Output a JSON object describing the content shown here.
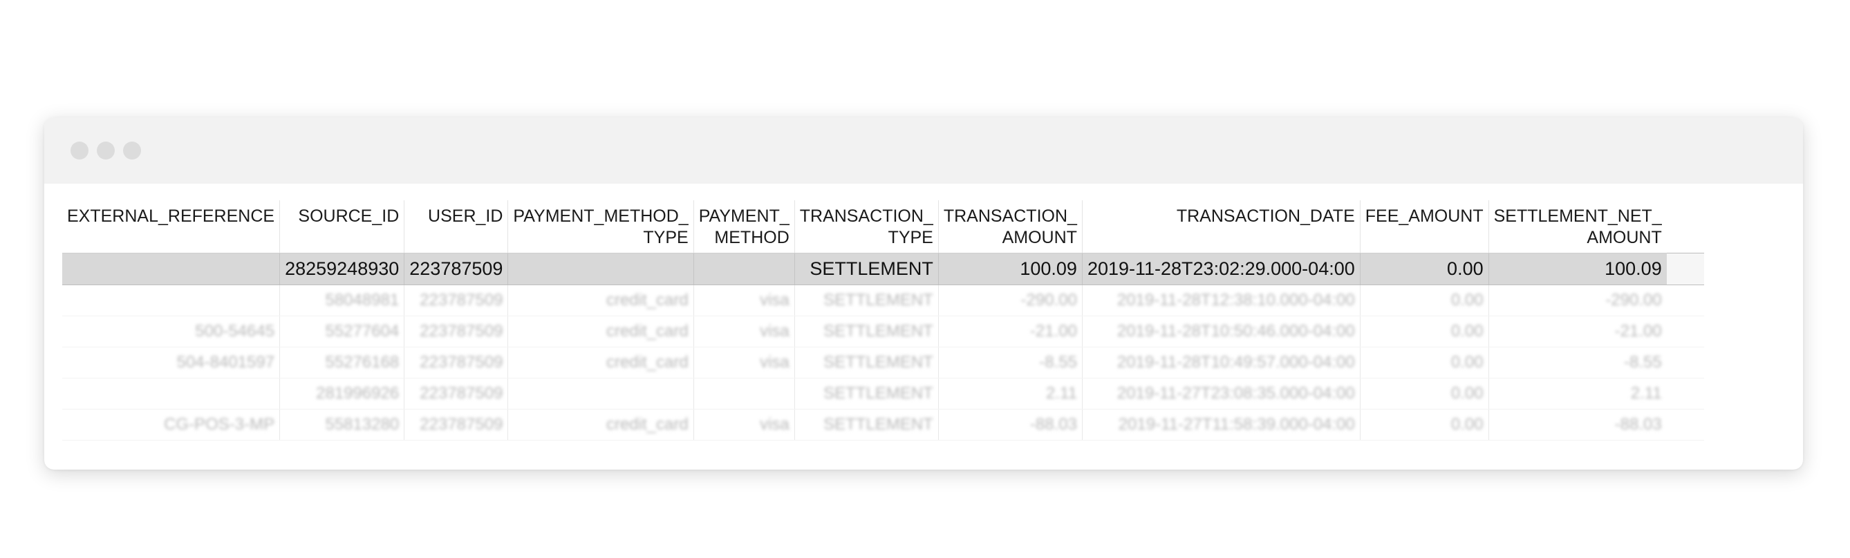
{
  "window": {
    "controls": [
      "close-dot",
      "minimize-dot",
      "maximize-dot"
    ]
  },
  "table": {
    "headers": [
      [
        "EXTERNAL_REFERENCE",
        ""
      ],
      [
        "SOURCE_ID",
        ""
      ],
      [
        "USER_ID",
        ""
      ],
      [
        "PAYMENT_METHOD_",
        "TYPE"
      ],
      [
        "PAYMENT_",
        "METHOD"
      ],
      [
        "TRANSACTION_",
        "TYPE"
      ],
      [
        "TRANSACTION_",
        "AMOUNT"
      ],
      [
        "TRANSACTION_DATE",
        ""
      ],
      [
        "FEE_AMOUNT",
        ""
      ],
      [
        "SETTLEMENT_NET_",
        "AMOUNT"
      ]
    ],
    "highlighted_row": [
      "",
      "28259248930",
      "223787509",
      "",
      "",
      "SETTLEMENT",
      "100.09",
      "2019-11-28T23:02:29.000-04:00",
      "0.00",
      "100.09"
    ],
    "faded_rows": [
      [
        "",
        "58048981",
        "223787509",
        "credit_card",
        "visa",
        "SETTLEMENT",
        "-290.00",
        "2019-11-28T12:38:10.000-04:00",
        "0.00",
        "-290.00"
      ],
      [
        "500-54645",
        "55277604",
        "223787509",
        "credit_card",
        "visa",
        "SETTLEMENT",
        "-21.00",
        "2019-11-28T10:50:46.000-04:00",
        "0.00",
        "-21.00"
      ],
      [
        "504-8401597",
        "55276168",
        "223787509",
        "credit_card",
        "visa",
        "SETTLEMENT",
        "-8.55",
        "2019-11-28T10:49:57.000-04:00",
        "0.00",
        "-8.55"
      ],
      [
        "",
        "281996926",
        "223787509",
        "",
        "",
        "SETTLEMENT",
        "2.11",
        "2019-11-27T23:08:35.000-04:00",
        "0.00",
        "2.11"
      ],
      [
        "CG-POS-3-MP",
        "55813280",
        "223787509",
        "credit_card",
        "visa",
        "SETTLEMENT",
        "-88.03",
        "2019-11-27T11:58:39.000-04:00",
        "0.00",
        "-88.03"
      ]
    ]
  }
}
